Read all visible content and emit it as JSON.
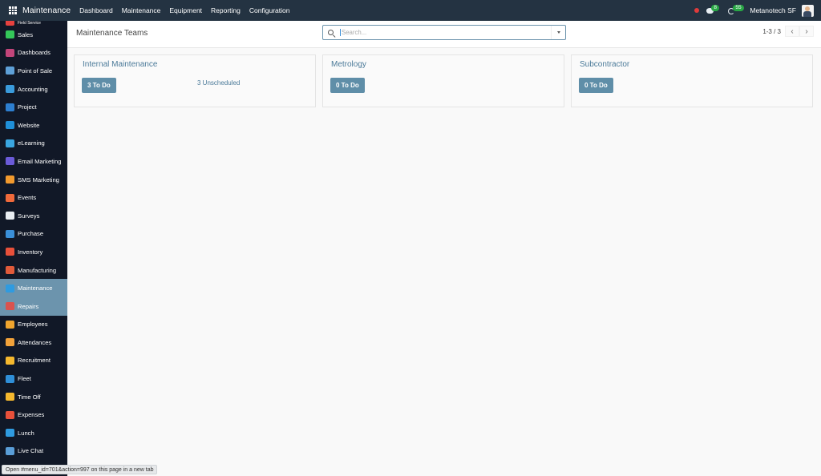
{
  "navbar": {
    "app_title": "Maintenance",
    "menu": [
      "Dashboard",
      "Maintenance",
      "Equipment",
      "Reporting",
      "Configuration"
    ],
    "messages_count": "8",
    "activities_count": "55",
    "company": "Metanotech SF"
  },
  "sidebar": {
    "items": [
      {
        "label": "Field Service",
        "icon": "field-service-icon",
        "color": "#e6413f",
        "active": false,
        "partial": true
      },
      {
        "label": "Sales",
        "icon": "sales-icon",
        "color": "#34c759",
        "active": false
      },
      {
        "label": "Dashboards",
        "icon": "dashboards-icon",
        "color": "#c2457a",
        "active": false
      },
      {
        "label": "Point of Sale",
        "icon": "point-of-sale-icon",
        "color": "#5ea0d8",
        "active": false
      },
      {
        "label": "Accounting",
        "icon": "accounting-icon",
        "color": "#3a9bdc",
        "active": false
      },
      {
        "label": "Project",
        "icon": "project-icon",
        "color": "#2d7fd0",
        "active": false
      },
      {
        "label": "Website",
        "icon": "website-icon",
        "color": "#1f8fd8",
        "active": false
      },
      {
        "label": "eLearning",
        "icon": "elearning-icon",
        "color": "#3aa6e0",
        "active": false
      },
      {
        "label": "Email Marketing",
        "icon": "email-marketing-icon",
        "color": "#6b5bd8",
        "active": false
      },
      {
        "label": "SMS Marketing",
        "icon": "sms-marketing-icon",
        "color": "#f29a2e",
        "active": false
      },
      {
        "label": "Events",
        "icon": "events-icon",
        "color": "#f06a3b",
        "active": false
      },
      {
        "label": "Surveys",
        "icon": "surveys-icon",
        "color": "#e9edf2",
        "active": false
      },
      {
        "label": "Purchase",
        "icon": "purchase-icon",
        "color": "#3a8fd8",
        "active": false
      },
      {
        "label": "Inventory",
        "icon": "inventory-icon",
        "color": "#e8503a",
        "active": false
      },
      {
        "label": "Manufacturing",
        "icon": "manufacturing-icon",
        "color": "#e05a3a",
        "active": false
      },
      {
        "label": "Maintenance",
        "icon": "maintenance-icon",
        "color": "#2f9be0",
        "active": true
      },
      {
        "label": "Repairs",
        "icon": "repairs-icon",
        "color": "#d9534f",
        "active": true
      },
      {
        "label": "Employees",
        "icon": "employees-icon",
        "color": "#f0a52e",
        "active": false
      },
      {
        "label": "Attendances",
        "icon": "attendances-icon",
        "color": "#f2a23a",
        "active": false
      },
      {
        "label": "Recruitment",
        "icon": "recruitment-icon",
        "color": "#f5b82e",
        "active": false
      },
      {
        "label": "Fleet",
        "icon": "fleet-icon",
        "color": "#2f8fd8",
        "active": false
      },
      {
        "label": "Time Off",
        "icon": "time-off-icon",
        "color": "#f5b82e",
        "active": false
      },
      {
        "label": "Expenses",
        "icon": "expenses-icon",
        "color": "#e8503a",
        "active": false
      },
      {
        "label": "Lunch",
        "icon": "lunch-icon",
        "color": "#2f9be0",
        "active": false
      },
      {
        "label": "Live Chat",
        "icon": "live-chat-icon",
        "color": "#5a9ed8",
        "active": false
      }
    ]
  },
  "control_panel": {
    "title": "Maintenance Teams",
    "search_placeholder": "Search...",
    "pager": "1-3 / 3",
    "prev": "‹",
    "next": "›"
  },
  "teams": [
    {
      "name": "Internal Maintenance",
      "todo_label": "3 To Do",
      "unscheduled_label": "3 Unscheduled"
    },
    {
      "name": "Metrology",
      "todo_label": "0 To Do"
    },
    {
      "name": "Subcontractor",
      "todo_label": "0 To Do"
    }
  ],
  "status_bar": {
    "text": "Open #menu_id=701&action=997 on this page in a new tab"
  },
  "colors": {
    "navbar_bg": "#243342",
    "sidebar_bg": "#111827",
    "sidebar_active": "#6c94ad",
    "accent": "#5f8ea8",
    "link": "#4b7a99",
    "badge_green": "#28a745",
    "record_red": "#e03b3b"
  }
}
